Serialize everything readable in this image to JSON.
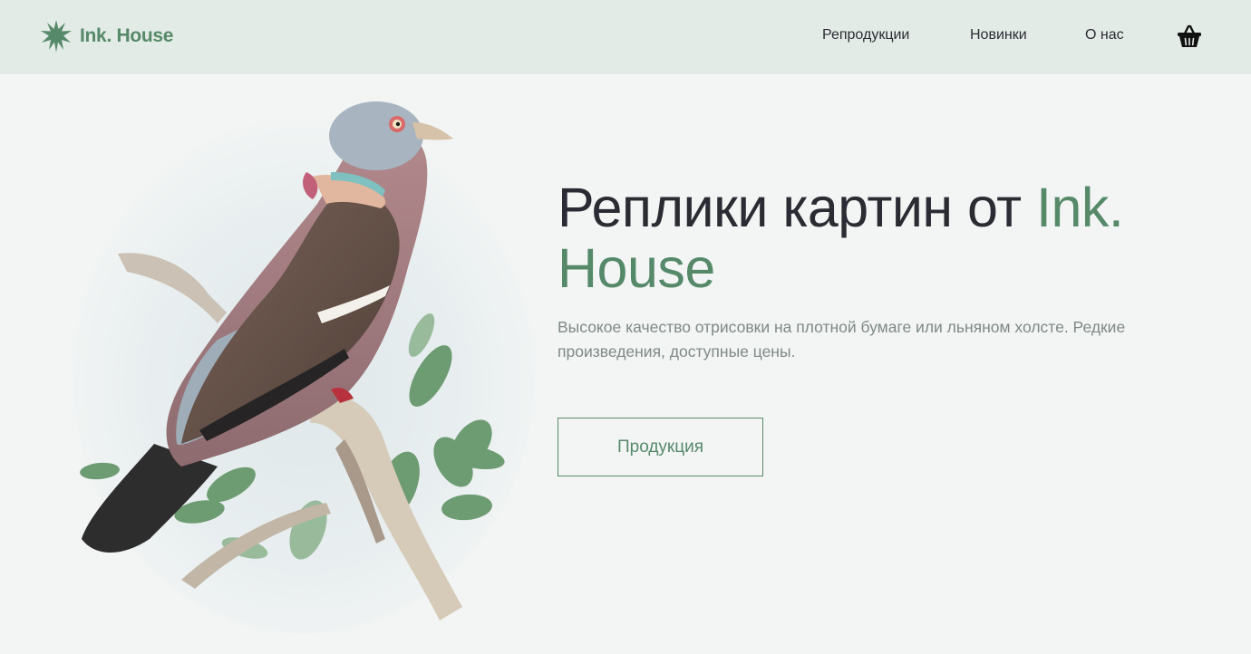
{
  "brand": {
    "name": "Ink. House",
    "accent_color": "#56896a",
    "header_bg": "#e3ebe6",
    "page_bg": "#f3f5f4"
  },
  "nav": {
    "items": [
      {
        "label": "Репродукции"
      },
      {
        "label": "Новинки"
      },
      {
        "label": "О нас"
      }
    ],
    "cart_icon": "basket-icon"
  },
  "hero": {
    "title_main": "Реплики картин от ",
    "title_accent": "Ink. House",
    "subtitle": "Высокое качество отрисовки на плотной бумаге или льняном холсте. Редкие произведения, доступные цены.",
    "cta_label": "Продукция",
    "image_icon": "pigeon-illustration"
  }
}
